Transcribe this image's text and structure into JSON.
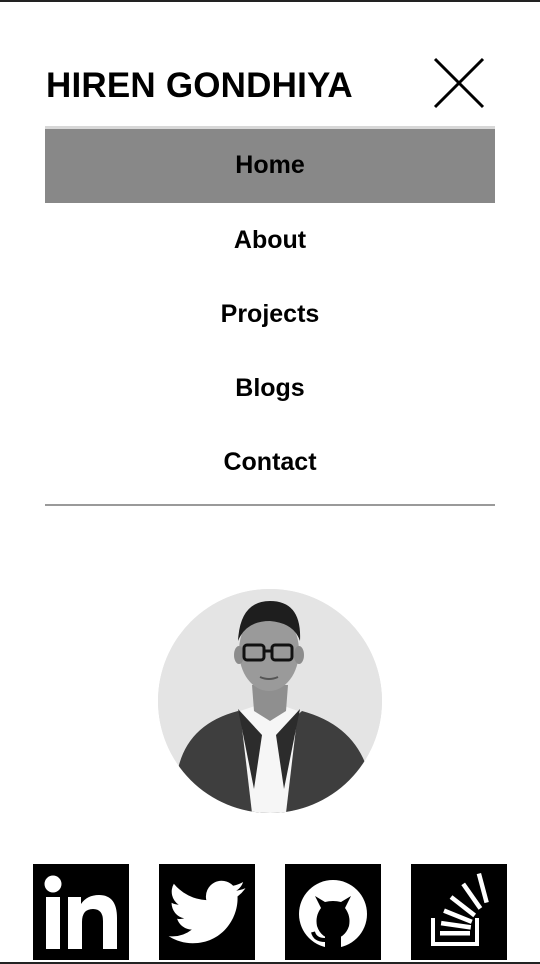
{
  "header": {
    "brand": "HIREN GONDHIYA",
    "close_icon": "close-icon"
  },
  "nav": {
    "items": [
      {
        "label": "Home",
        "active": true
      },
      {
        "label": "About",
        "active": false
      },
      {
        "label": "Projects",
        "active": false
      },
      {
        "label": "Blogs",
        "active": false
      },
      {
        "label": "Contact",
        "active": false
      }
    ]
  },
  "profile": {
    "avatar": "profile-photo"
  },
  "social": [
    {
      "icon": "linkedin-icon"
    },
    {
      "icon": "twitter-icon"
    },
    {
      "icon": "github-icon"
    },
    {
      "icon": "stackoverflow-icon"
    }
  ],
  "colors": {
    "active_background": "#888888",
    "text": "#000000",
    "social_background": "#000000"
  }
}
